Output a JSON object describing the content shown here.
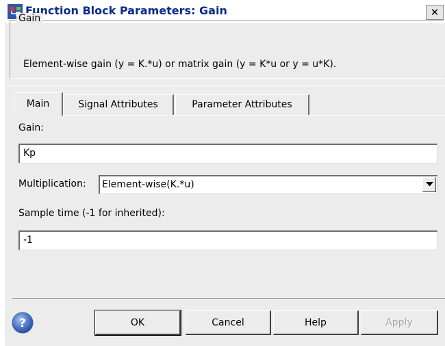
{
  "window": {
    "title": "Function Block Parameters: Gain",
    "close_label": "✕"
  },
  "description": {
    "group_title": "Gain",
    "text": "Element-wise gain (y = K.*u) or matrix gain (y = K*u or y = u*K)."
  },
  "tabs": [
    {
      "label": "Main",
      "active": true
    },
    {
      "label": "Signal Attributes",
      "active": false
    },
    {
      "label": "Parameter Attributes",
      "active": false
    }
  ],
  "fields": {
    "gain_label": "Gain:",
    "gain_value": "Kp",
    "multiplication_label": "Multiplication:",
    "multiplication_value": "Element-wise(K.*u)",
    "sample_time_label": "Sample time (-1 for inherited):",
    "sample_time_value": "-1"
  },
  "buttons": {
    "ok": "OK",
    "cancel": "Cancel",
    "help": "Help",
    "apply": "Apply"
  },
  "icons": {
    "app": "simulink-block-icon",
    "help": "question-mark-icon",
    "dropdown": "dropdown-arrow-icon"
  },
  "colors": {
    "title_text": "#0b2a8c",
    "dialog_bg": "#ececec",
    "help_icon": "#3a66b5"
  }
}
